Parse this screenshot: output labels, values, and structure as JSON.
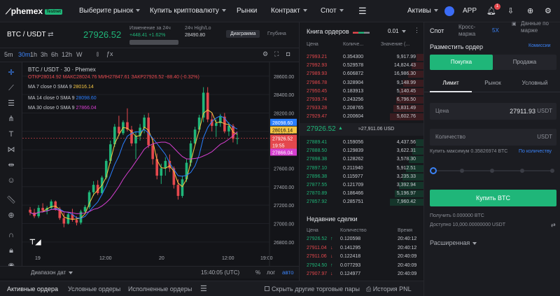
{
  "nav": {
    "logo": "phemex",
    "logo_badge": "Testnet",
    "items": [
      "Выберите рынок",
      "Купить криптовалюту",
      "Рынки",
      "Контракт",
      "Спот"
    ],
    "assets": "Активы",
    "app": "APP",
    "notify_count": "1"
  },
  "ticker": {
    "pair": "BTC / USDT",
    "price": "27926.52",
    "change_label": "Изменение за 24ч",
    "change_value": "+448.41 +1.62%",
    "hl_label": "24ч High/Lo",
    "hl_value": "28490.80",
    "btn_diagram": "Диаграмма",
    "btn_depth": "Глубина"
  },
  "chart_toolbar": {
    "intervals": [
      "5m",
      "30m",
      "1h",
      "3h",
      "6h",
      "12h",
      "W"
    ],
    "active": "30m"
  },
  "chart_legend": {
    "title": "BTC / USDT · 30 · Phemex",
    "ohlc": "ОТКР28014.92 МАКС28024.76 МИН27847.61 ЗАКР27926.52 -88.40 (-0.32%)",
    "ma7_label": "MA 7 close 0 SMA 9",
    "ma7_value": "28016.14",
    "ma14_label": "MA 14 close 0 SMA 9",
    "ma14_value": "28098.60",
    "ma30_label": "MA 30 close 0 SMA 9",
    "ma30_value": "27866.04"
  },
  "chart_data": {
    "type": "candlestick",
    "y_ticks": [
      "28600.00",
      "28400.00",
      "28200.00",
      "28000.00",
      "27800.00",
      "27600.00",
      "27400.00",
      "27200.00",
      "27000.00",
      "26800.00"
    ],
    "x_ticks": [
      "19",
      "12:00",
      "20",
      "12:00",
      "19:00"
    ],
    "ylim": [
      26700,
      28750
    ],
    "price_tags": [
      {
        "value": "28098.60",
        "color": "#2a7fff"
      },
      {
        "value": "28016.14",
        "color": "#f5c542"
      },
      {
        "value": "27926.52",
        "color": "#e5484d"
      },
      {
        "value": "19:55",
        "color": "#e5484d"
      },
      {
        "value": "27866.04",
        "color": "#d63fd0"
      }
    ],
    "candles": [
      [
        27150,
        27180,
        27090,
        27120
      ],
      [
        27120,
        27160,
        27060,
        27080
      ],
      [
        27080,
        27200,
        27060,
        27170
      ],
      [
        27170,
        27220,
        27120,
        27140
      ],
      [
        27140,
        27190,
        27100,
        27170
      ],
      [
        27170,
        27260,
        27150,
        27240
      ],
      [
        27240,
        27250,
        27140,
        27160
      ],
      [
        27160,
        27180,
        27040,
        27060
      ],
      [
        27060,
        27120,
        26960,
        27000
      ],
      [
        27000,
        27120,
        26990,
        27100
      ],
      [
        27100,
        27160,
        27020,
        27040
      ],
      [
        27040,
        27080,
        26980,
        27010
      ],
      [
        27010,
        27150,
        26990,
        27130
      ],
      [
        27130,
        27200,
        27100,
        27180
      ],
      [
        27180,
        27360,
        27160,
        27340
      ],
      [
        27340,
        27460,
        27300,
        27420
      ],
      [
        27420,
        27470,
        27310,
        27330
      ],
      [
        27330,
        27520,
        27310,
        27500
      ],
      [
        27500,
        27700,
        27480,
        27680
      ],
      [
        27680,
        27900,
        27650,
        27860
      ],
      [
        27860,
        28080,
        27830,
        28050
      ],
      [
        28050,
        28170,
        27950,
        27980
      ],
      [
        27980,
        28120,
        27960,
        28100
      ],
      [
        28100,
        28250,
        28000,
        28020
      ],
      [
        28020,
        28060,
        27840,
        27870
      ],
      [
        27870,
        28000,
        27700,
        27950
      ],
      [
        27950,
        28080,
        27900,
        28040
      ],
      [
        28040,
        28180,
        27980,
        28150
      ],
      [
        28150,
        28200,
        27820,
        27850
      ],
      [
        27850,
        27920,
        27640,
        27700
      ],
      [
        27700,
        27760,
        27480,
        27520
      ],
      [
        27520,
        27650,
        27430,
        27600
      ],
      [
        27600,
        27720,
        27520,
        27680
      ],
      [
        27680,
        27750,
        27560,
        27600
      ],
      [
        27600,
        27620,
        27380,
        27420
      ],
      [
        27420,
        27480,
        27260,
        27300
      ],
      [
        27300,
        27520,
        27280,
        27480
      ],
      [
        27480,
        27700,
        27450,
        27660
      ],
      [
        27660,
        27900,
        27620,
        27870
      ],
      [
        27870,
        28050,
        27850,
        28020
      ],
      [
        28020,
        28180,
        27990,
        28150
      ],
      [
        28150,
        28480,
        28100,
        28420
      ],
      [
        28420,
        28480,
        28100,
        28130
      ],
      [
        28130,
        28200,
        28000,
        28060
      ],
      [
        28060,
        28130,
        27940,
        28090
      ],
      [
        28090,
        28190,
        28050,
        28160
      ],
      [
        28160,
        28200,
        27980,
        28000
      ],
      [
        28000,
        28100,
        27950,
        28060
      ],
      [
        28060,
        28080,
        27880,
        27920
      ],
      [
        27920,
        27990,
        27860,
        27926.52
      ]
    ]
  },
  "chart_bottom": {
    "range": "Диапазон дат",
    "time": "15:40:05 (UTC)",
    "pct": "%",
    "log": "лог",
    "auto": "авто"
  },
  "orderbook": {
    "title": "Книга ордеров",
    "precision": "0.01",
    "headers": [
      "Цена",
      "Количе...",
      "Значение (..."
    ],
    "asks": [
      [
        "27993.21",
        "0.354300",
        "9,917.99",
        0.18
      ],
      [
        "27992.93",
        "0.529578",
        "14,824.43",
        0.3
      ],
      [
        "27989.93",
        "0.606872",
        "16,986.30",
        0.38
      ],
      [
        "27986.78",
        "0.328904",
        "9,148.99",
        0.5
      ],
      [
        "27950.45",
        "0.183913",
        "5,140.45",
        0.58
      ],
      [
        "27939.74",
        "0.243256",
        "6,796.50",
        0.66
      ],
      [
        "27933.28",
        "0.208765",
        "5,831.49",
        0.74
      ],
      [
        "27929.47",
        "0.200604",
        "5,602.76",
        0.82
      ]
    ],
    "mid_price": "27926.52",
    "mid_sub": "≈27,911.06 USD",
    "bids": [
      [
        "27889.41",
        "0.159056",
        "4,437.56",
        0.2
      ],
      [
        "27888.50",
        "0.129839",
        "3,622.31",
        0.28
      ],
      [
        "27898.38",
        "0.128262",
        "3,578.30",
        0.36
      ],
      [
        "27897.10",
        "0.211940",
        "5,912.51",
        0.44
      ],
      [
        "27896.38",
        "0.115977",
        "3,235.33",
        0.52
      ],
      [
        "27877.55",
        "0.121709",
        "3,392.94",
        0.6
      ],
      [
        "27870.89",
        "0.186466",
        "5,196.97",
        0.7
      ],
      [
        "27857.92",
        "0.285751",
        "7,960.42",
        0.82
      ]
    ]
  },
  "trades": {
    "title": "Недавние сделки",
    "headers": [
      "Цена",
      "Количество",
      "Время"
    ],
    "rows": [
      [
        "27926.52",
        "↑",
        "0.120598",
        "20:40:12",
        "g"
      ],
      [
        "27911.04",
        "↓",
        "0.141295",
        "20:40:12",
        "r"
      ],
      [
        "27911.06",
        "↓",
        "0.122418",
        "20:40:09",
        "r"
      ],
      [
        "27924.50",
        "↑",
        "0.077293",
        "20:40:09",
        "g"
      ],
      [
        "27907.97",
        "↓",
        "0.124977",
        "20:40:09",
        "r"
      ]
    ]
  },
  "form": {
    "tabs": [
      "Спот",
      "Кросс-маржа",
      "5X",
      "Данные по марже"
    ],
    "place": "Разместить ордер",
    "fees": "Комиссии",
    "buy": "Покупка",
    "sell": "Продажа",
    "types": [
      "Лимит",
      "Рынок",
      "Условный"
    ],
    "price_label": "Цена",
    "price_value": "27911.93",
    "price_unit": "USDT",
    "qty_label": "Количество",
    "qty_unit": "USDT",
    "max_label": "Купить максимум 0.35826974 BTC",
    "by_qty": "По количеству",
    "buy_btn": "Купить BTC",
    "receive": "Получить 0.000000 BTC",
    "available": "Доступно 10,000.00000000 USDT",
    "advanced": "Расширенная"
  },
  "bottom_tabs": {
    "active_orders": "Активные ордера",
    "cond_orders": "Условные ордеры",
    "filled_orders": "Исполненные ордеры",
    "hide_other": "Скрыть другие торговые пары",
    "history": "История PNL"
  }
}
